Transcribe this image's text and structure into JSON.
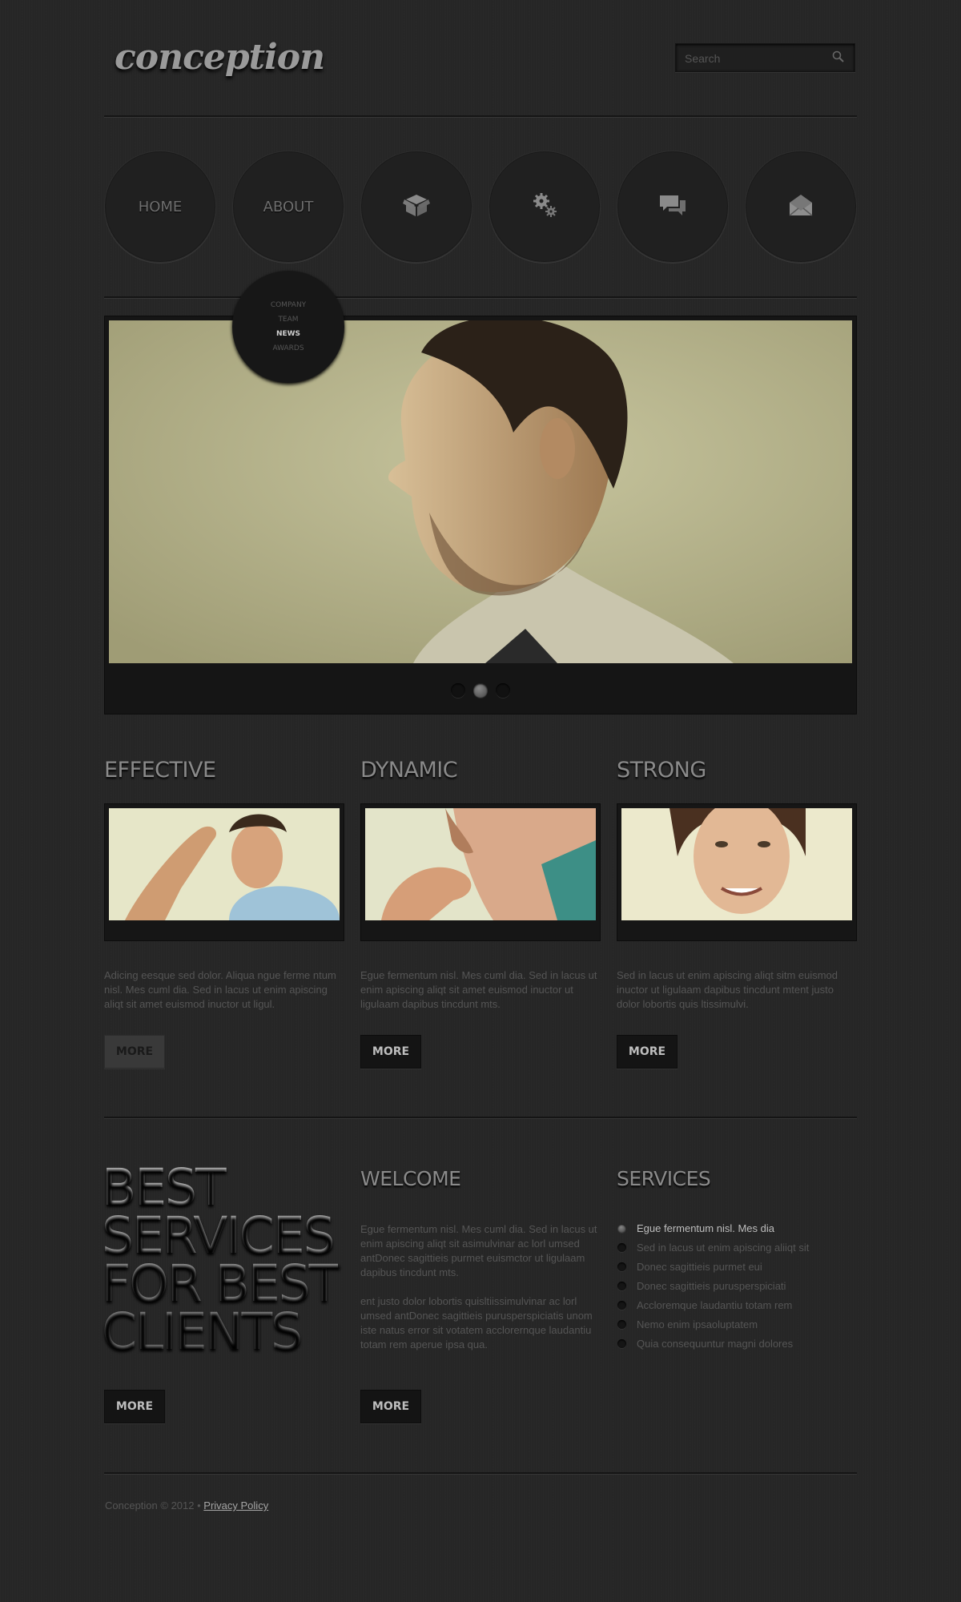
{
  "header": {
    "logo": "conception",
    "search_placeholder": "Search"
  },
  "nav": {
    "items": [
      {
        "label": "HOME",
        "icon": null
      },
      {
        "label": "ABOUT",
        "icon": null
      },
      {
        "label": "",
        "icon": "box-icon"
      },
      {
        "label": "",
        "icon": "gears-icon"
      },
      {
        "label": "",
        "icon": "chat-icon"
      },
      {
        "label": "",
        "icon": "envelope-icon"
      }
    ],
    "submenu": [
      "COMPANY",
      "TEAM",
      "NEWS",
      "AWARDS"
    ],
    "submenu_active": "NEWS"
  },
  "slider": {
    "dot_count": 3,
    "active_dot": 2
  },
  "columns": [
    {
      "title": "EFFECTIVE",
      "text": "Adicing eesque sed dolor. Aliqua ngue ferme ntum nisl. Mes cuml dia. Sed in lacus ut enim apiscing aliqt sit amet euismod inuctor ut ligul.",
      "more": "MORE"
    },
    {
      "title": "DYNAMIC",
      "text": "Egue fermentum nisl. Mes cuml dia. Sed in lacus ut enim apiscing aliqt sit amet euismod inuctor ut ligulaam dapibus tincdunt mts.",
      "more": "MORE"
    },
    {
      "title": "STRONG",
      "text": "Sed in lacus ut enim apiscing aliqt sitm euismod inuctor ut ligulaam dapibus tincdunt mtent justo dolor lobortis quis ltissimulvi.",
      "more": "MORE"
    }
  ],
  "bottom": {
    "big_lines": [
      "BEST",
      "SERVICES",
      "FOR BEST",
      "CLIENTS"
    ],
    "big_more": "MORE",
    "welcome_title": "WELCOME",
    "welcome_p1": "Egue fermentum nisl. Mes cuml dia. Sed in lacus ut enim apiscing aliqt sit asimulvinar ac lorl umsed antDonec sagittieis purmet euismctor ut ligulaam dapibus tincdunt mts.",
    "welcome_p2": "ent justo dolor lobortis quisltiissimulvinar ac lorl umsed antDonec sagittieis purusperspiciatis unom iste natus error sit votatem acclorernque laudantiu totam rem aperue ipsa qua.",
    "welcome_more": "MORE",
    "services_title": "SERVICES",
    "services": [
      "Egue fermentum nisl. Mes  dia",
      "Sed in lacus ut enim apiscing aliiqt sit",
      "Donec sagittieis purmet eui",
      "Donec sagittieis purusperspiciati",
      "Accloremque laudantiu totam rem",
      "Nemo enim ipsaoluptatem",
      "Quia consequuntur magni dolores"
    ]
  },
  "footer": {
    "copyright": "Conception © 2012 •",
    "privacy": "Privacy Policy"
  }
}
